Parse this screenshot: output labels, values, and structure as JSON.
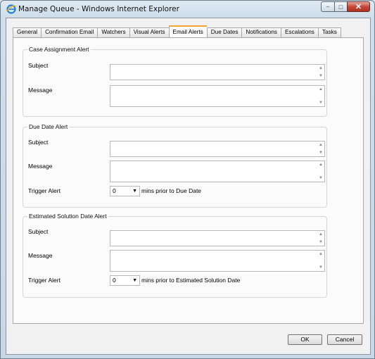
{
  "window": {
    "title": "Manage Queue - Windows Internet Explorer",
    "icon": "ie-icon",
    "controls": {
      "minimize": "–",
      "maximize": "□",
      "close": "✕"
    }
  },
  "tabs": [
    {
      "label": "General"
    },
    {
      "label": "Confirmation Email"
    },
    {
      "label": "Watchers"
    },
    {
      "label": "Visual Alerts"
    },
    {
      "label": "Email Alerts",
      "active": true
    },
    {
      "label": "Due Dates"
    },
    {
      "label": "Notifications"
    },
    {
      "label": "Escalations"
    },
    {
      "label": "Tasks"
    }
  ],
  "case_assignment": {
    "legend": "Case Assignment Alert",
    "subject_label": "Subject",
    "subject_value": "",
    "message_label": "Message",
    "message_value": ""
  },
  "due_date": {
    "legend": "Due Date Alert",
    "subject_label": "Subject",
    "subject_value": "",
    "message_label": "Message",
    "message_value": "",
    "trigger_label": "Trigger Alert",
    "trigger_value": "0",
    "trigger_suffix": "mins prior to Due Date"
  },
  "estimated_solution": {
    "legend": "Estimated Solution Date Alert",
    "subject_label": "Subject",
    "subject_value": "",
    "message_label": "Message",
    "message_value": "",
    "trigger_label": "Trigger Alert",
    "trigger_value": "0",
    "trigger_suffix": "mins prior to Estimated Solution Date"
  },
  "buttons": {
    "ok": "OK",
    "cancel": "Cancel"
  },
  "colors": {
    "active_tab_accent": "#f2a632",
    "close_button": "#c5483a"
  }
}
